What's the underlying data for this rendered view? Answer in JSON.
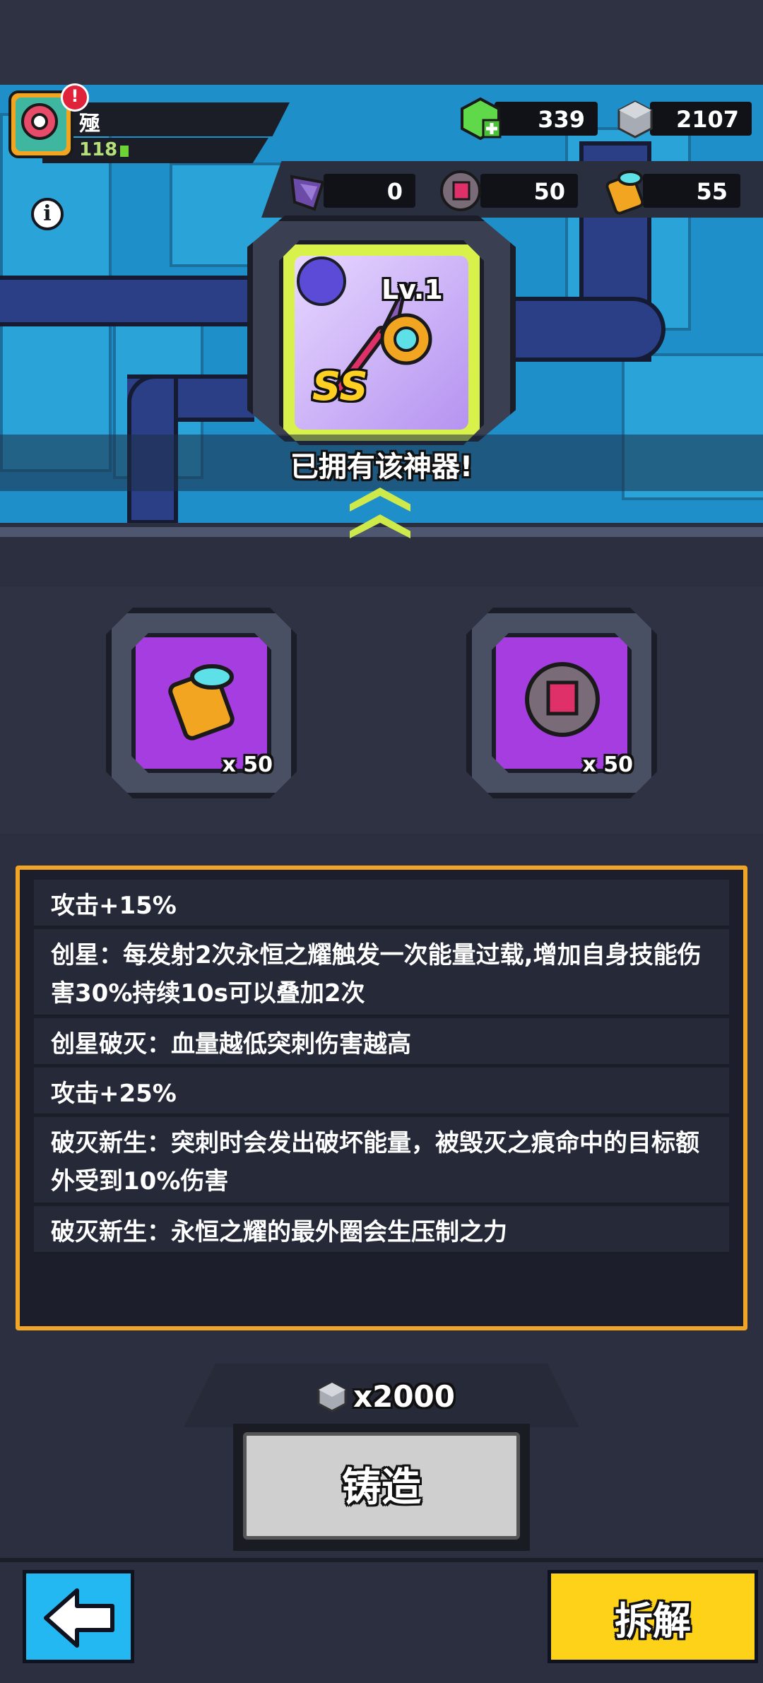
{
  "player": {
    "name": "殛",
    "level": "118",
    "alert": "!"
  },
  "currencies": {
    "green_gem": "339",
    "steel_cube": "2107",
    "purple_shard": "0",
    "red_orb": "50",
    "tech_cylinder": "55"
  },
  "artifact": {
    "level": "Lv.1",
    "grade": "SS",
    "owned_text": "已拥有该神器!"
  },
  "materials": [
    {
      "name": "tech_cylinder",
      "count": "x 50"
    },
    {
      "name": "red_orb",
      "count": "x 50"
    }
  ],
  "effects": [
    "攻击+15%",
    "创星：每发射2次永恒之耀触发一次能量过载,增加自身技能伤害30%持续10s可以叠加2次",
    "创星破灭：血量越低突刺伤害越高",
    "攻击+25%",
    "破灭新生：突刺时会发出破坏能量，被毁灭之痕命中的目标额外受到10%伤害",
    "破灭新生：永恒之耀的最外圈会生压制之力"
  ],
  "forge": {
    "cost": "x2000",
    "label": "铸造"
  },
  "bottom": {
    "dismantle_label": "拆解"
  },
  "colors": {
    "panel_border": "#f0a526",
    "dismantle_button": "#ffd21a",
    "back_button": "#24b8f2",
    "material_slot": "#a53de0"
  }
}
